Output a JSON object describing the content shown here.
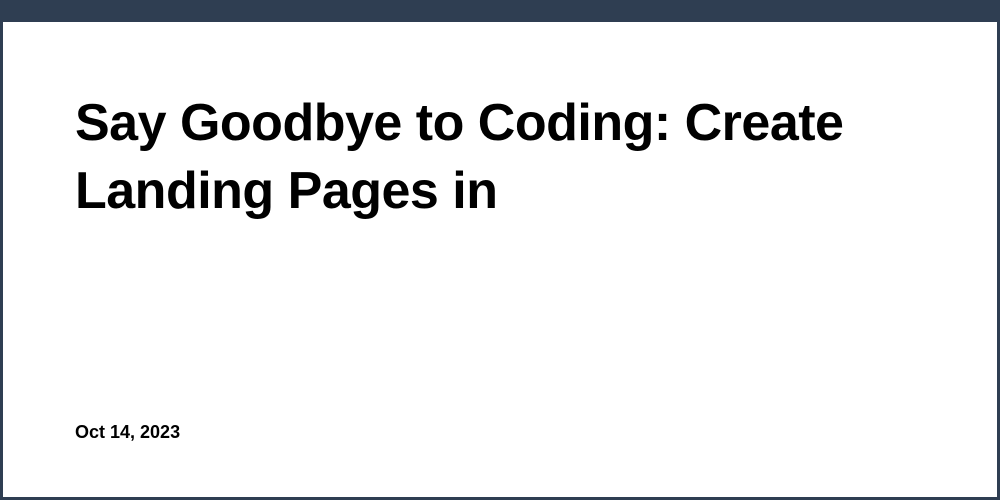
{
  "article": {
    "title": "Say Goodbye to Coding: Create Landing Pages in",
    "date": "Oct 14, 2023"
  }
}
